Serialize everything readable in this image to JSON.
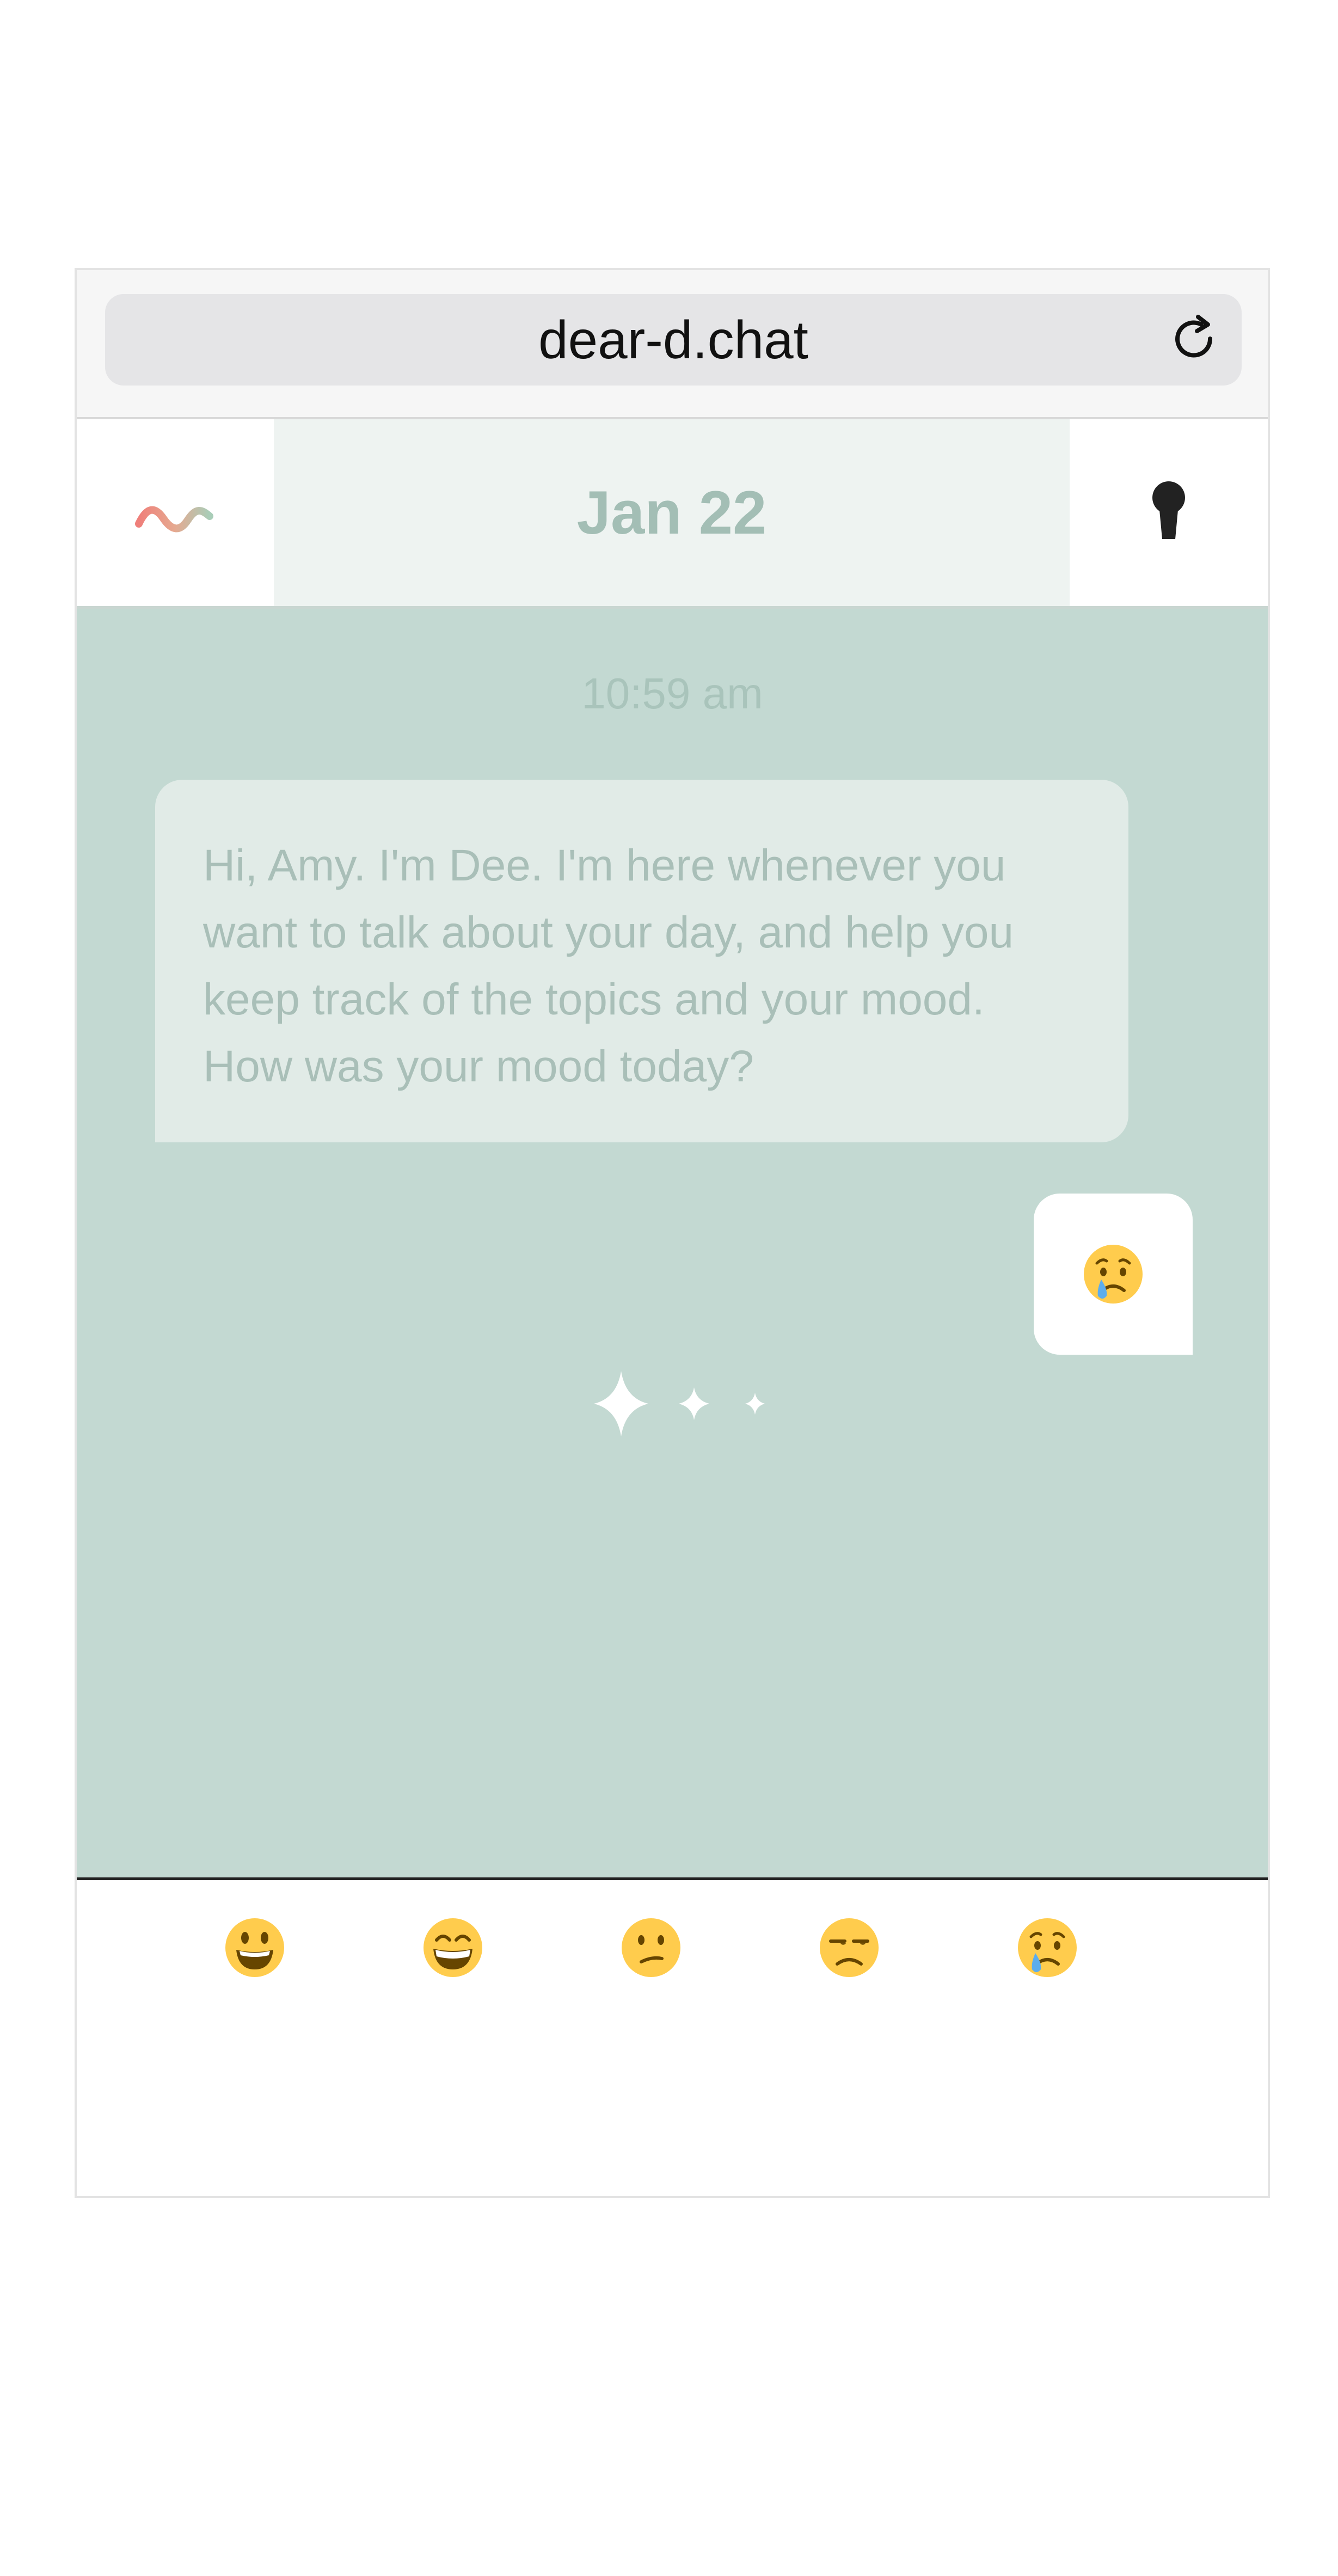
{
  "browser": {
    "url": "dear-d.chat",
    "reload_icon": "reload-icon"
  },
  "header": {
    "logo_icon": "wave-logo-icon",
    "date": "Jan 22",
    "lock_icon": "keyhole-icon"
  },
  "chat": {
    "timestamp": "10:59 am",
    "messages": [
      {
        "sender": "bot",
        "text": "Hi, Amy. I'm Dee. I'm here whenever you want to talk about your day, and help you keep track of the topics and your mood. How was your mood today?"
      },
      {
        "sender": "user",
        "emoji": "crying-face-emoji"
      }
    ],
    "typing_indicator": "sparkles-icon"
  },
  "mood_picker": {
    "options": [
      "grinning-face-emoji",
      "beaming-face-emoji",
      "confused-face-emoji",
      "unamused-face-emoji",
      "crying-face-emoji"
    ]
  },
  "colors": {
    "chat_background": "#c3d9d2",
    "date_text": "#a3beb5",
    "bot_bubble": "#e1ebe7",
    "emoji_yellow": "#ffcc4d"
  }
}
